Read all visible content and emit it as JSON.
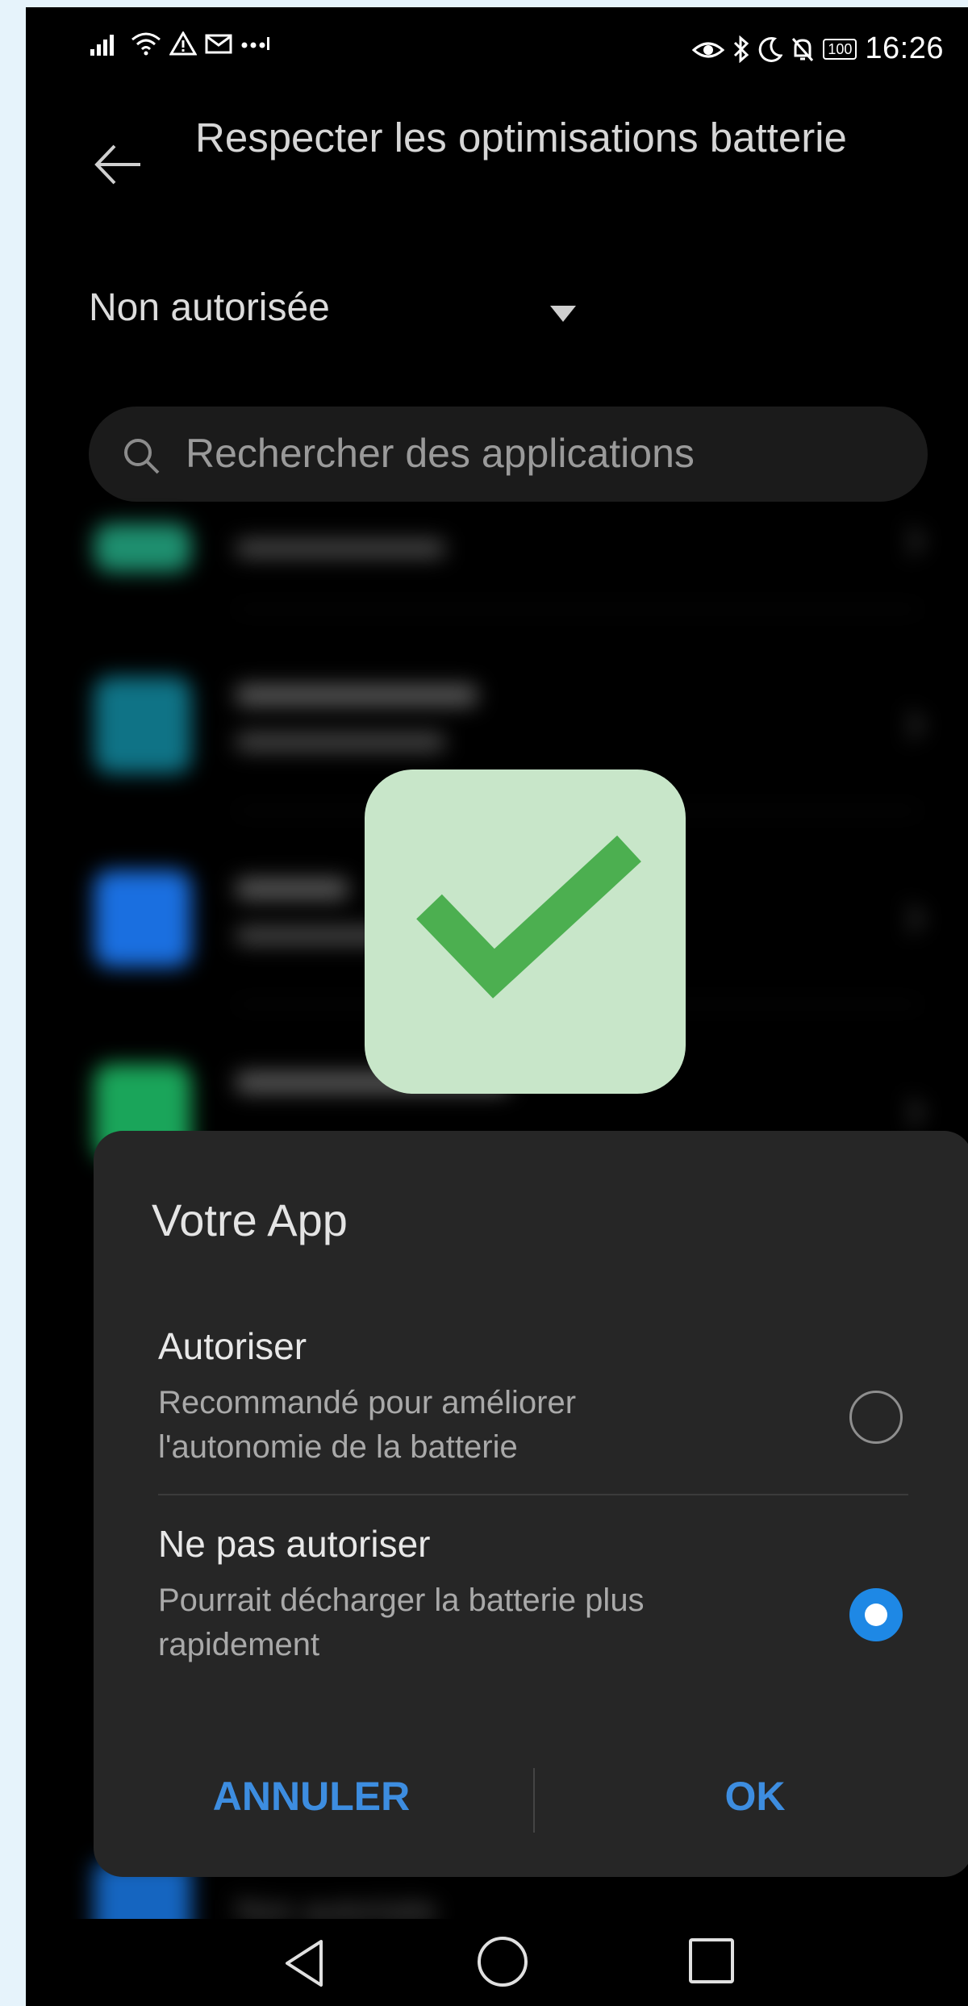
{
  "status_bar": {
    "left_icons": [
      "signal-icon",
      "wifi-icon",
      "warning-icon",
      "mail-icon",
      "more-dots-icon"
    ],
    "right_icons": [
      "eye-icon",
      "bluetooth-icon",
      "moon-icon",
      "bell-off-icon"
    ],
    "battery": "100",
    "time": "16:26"
  },
  "header": {
    "back_icon": "arrow-left-icon",
    "title": "Respecter les optimisations batterie"
  },
  "filter": {
    "selected": "Non autorisée"
  },
  "search": {
    "placeholder": "Rechercher des applications"
  },
  "dialog": {
    "title": "Votre App",
    "options": [
      {
        "label": "Autoriser",
        "description": "Recommandé pour améliorer l'autonomie de la batterie",
        "selected": false
      },
      {
        "label": "Ne pas autoriser",
        "description": "Pourrait décharger la batterie plus rapidement",
        "selected": true
      }
    ],
    "cancel_label": "ANNULER",
    "ok_label": "OK"
  },
  "peek_row": {
    "status": "Non autorisée"
  },
  "colors": {
    "accent": "#1e88e5",
    "check_green": "#4caf50",
    "check_bg": "#c8e6c9"
  }
}
